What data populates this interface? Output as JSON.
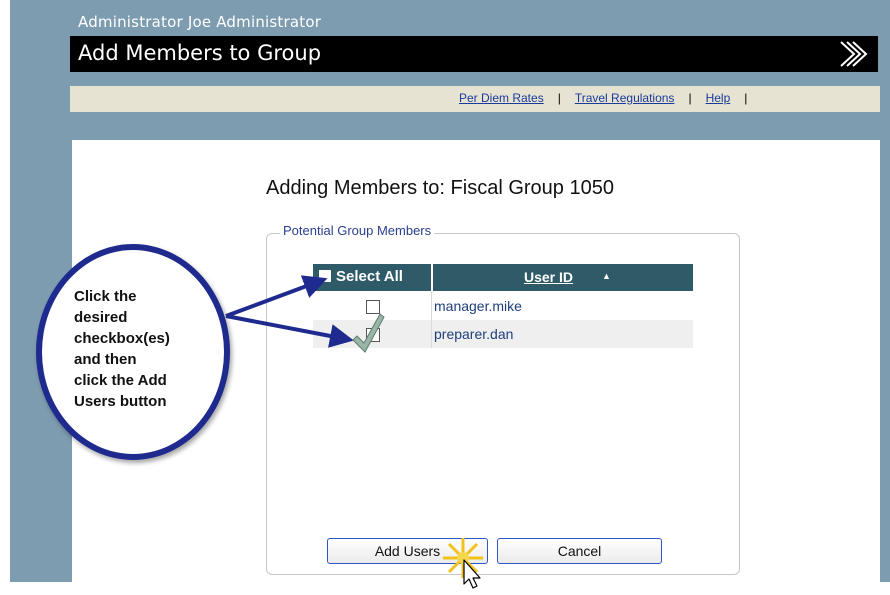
{
  "header": {
    "admin_label": "Administrator Joe Administrator",
    "title": "Add Members to Group"
  },
  "nav": {
    "links": [
      "Per Diem Rates",
      "Travel Regulations",
      "Help"
    ],
    "separator": "|"
  },
  "page": {
    "heading": "Adding Members to: Fiscal Group 1050"
  },
  "members_panel": {
    "legend": "Potential Group Members",
    "select_all_label": "Select All",
    "userid_header": "User ID",
    "sort_arrow": "▲",
    "rows": [
      {
        "user_id": "manager.mike",
        "checked": false
      },
      {
        "user_id": "preparer.dan",
        "checked": true
      }
    ]
  },
  "buttons": {
    "add_label": "Add Users",
    "cancel_label": "Cancel"
  },
  "callout": {
    "lines": [
      "Click the",
      "desired",
      "checkbox(es)",
      "and then",
      "click the Add",
      "Users button"
    ]
  },
  "colors": {
    "frame": "#7d9cb0",
    "grid_header": "#2f5b68",
    "callout_border": "#1f2a8e",
    "link": "#1a3a9c"
  }
}
